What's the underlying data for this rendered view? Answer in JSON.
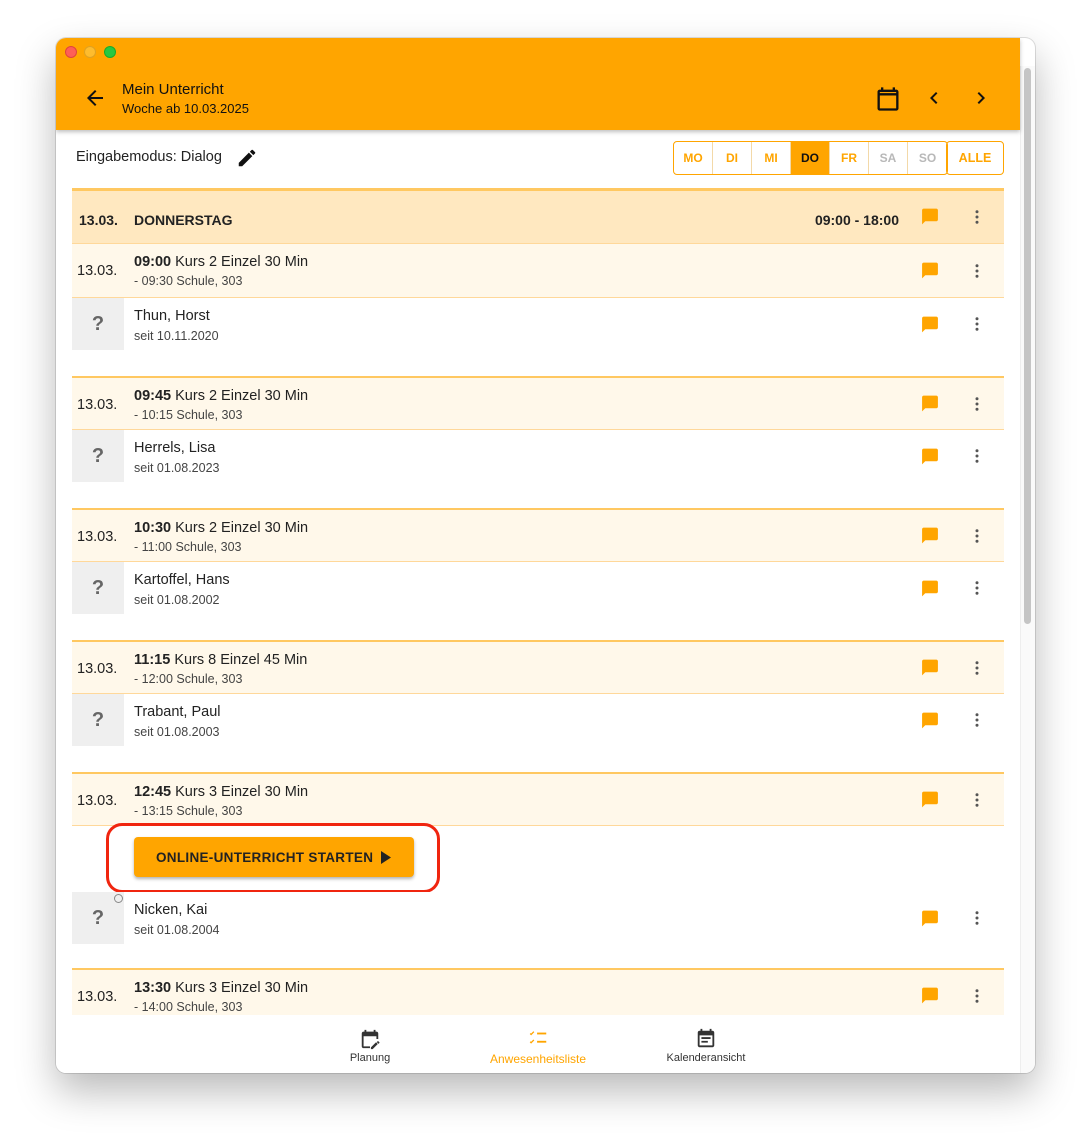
{
  "header": {
    "title": "Mein Unterricht",
    "subtitle": "Woche ab 10.03.2025",
    "icons": [
      "back-arrow-icon",
      "calendar-icon",
      "chevron-left-icon",
      "chevron-right-icon"
    ]
  },
  "toolbar": {
    "mode_label": "Eingabemodus: Dialog",
    "days": [
      "MO",
      "DI",
      "MI",
      "DO",
      "FR",
      "SA",
      "SO"
    ],
    "active_day": "DO",
    "all_label": "ALLE"
  },
  "day_header": {
    "date": "13.03.",
    "weekday": "DONNERSTAG",
    "time": "09:00 - 18:00"
  },
  "lessons": [
    {
      "date": "13.03.",
      "time": "09:00",
      "course": "Kurs 2 Einzel 30 Min",
      "detail": "- 09:30 Schule, 303",
      "student": {
        "name": "Thun, Horst",
        "since": "seit 10.11.2020",
        "status": "?"
      }
    },
    {
      "date": "13.03.",
      "time": "09:45",
      "course": "Kurs 2 Einzel 30 Min",
      "detail": "- 10:15 Schule, 303",
      "student": {
        "name": "Herrels, Lisa",
        "since": "seit 01.08.2023",
        "status": "?"
      }
    },
    {
      "date": "13.03.",
      "time": "10:30",
      "course": "Kurs 2 Einzel 30 Min",
      "detail": "- 11:00 Schule, 303",
      "student": {
        "name": "Kartoffel, Hans",
        "since": "seit 01.08.2002",
        "status": "?"
      }
    },
    {
      "date": "13.03.",
      "time": "11:15",
      "course": "Kurs 8 Einzel 45 Min",
      "detail": "- 12:00 Schule, 303",
      "student": {
        "name": "Trabant, Paul",
        "since": "seit 01.08.2003",
        "status": "?"
      }
    },
    {
      "date": "13.03.",
      "time": "12:45",
      "course": "Kurs 3 Einzel 30 Min",
      "detail": "- 13:15 Schule, 303",
      "online_button": "ONLINE-UNTERRICHT STARTEN",
      "student": {
        "name": "Nicken, Kai",
        "since": "seit 01.08.2004",
        "status": "?"
      }
    },
    {
      "date": "13.03.",
      "time": "13:30",
      "course": "Kurs 3 Einzel 30 Min",
      "detail": "- 14:00 Schule, 303"
    }
  ],
  "bottom_nav": [
    {
      "label": "Planung",
      "icon": "calendar-edit-icon"
    },
    {
      "label": "Anwesenheitsliste",
      "icon": "checklist-icon",
      "active": true
    },
    {
      "label": "Kalenderansicht",
      "icon": "event-note-icon"
    }
  ],
  "colors": {
    "accent": "#FFA500",
    "header_row": "#FFE8C0",
    "lesson_row": "#FFF8EA",
    "highlight": "#F0250F"
  }
}
